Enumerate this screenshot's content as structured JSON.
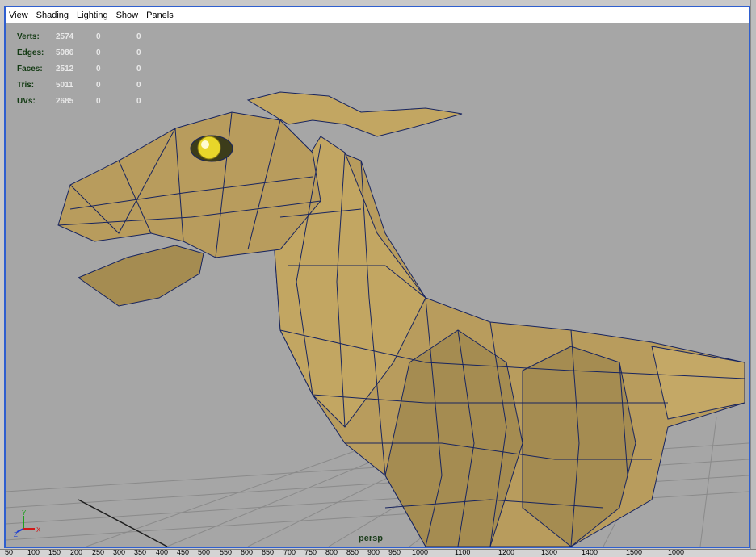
{
  "menu": [
    "View",
    "Shading",
    "Lighting",
    "Show",
    "Panels"
  ],
  "hud": [
    {
      "label": "Verts:",
      "value": "2574",
      "a": "0",
      "b": "0"
    },
    {
      "label": "Edges:",
      "value": "5086",
      "a": "0",
      "b": "0"
    },
    {
      "label": "Faces:",
      "value": "2512",
      "a": "0",
      "b": "0"
    },
    {
      "label": "Tris:",
      "value": "5011",
      "a": "0",
      "b": "0"
    },
    {
      "label": "UVs:",
      "value": "2685",
      "a": "0",
      "b": "0"
    }
  ],
  "camera": "persp",
  "axis": {
    "y": "Y",
    "z": "Z",
    "x": "X"
  },
  "ruler": [
    "50",
    "100",
    "150",
    "200",
    "250",
    "300",
    "350",
    "400",
    "450",
    "500",
    "550",
    "600",
    "650",
    "700",
    "750",
    "800",
    "850",
    "900",
    "950",
    "1000",
    "1100",
    "1200",
    "1300",
    "1400",
    "1500",
    "1000"
  ],
  "colors": {
    "background": "#a6a6a6",
    "model": "#b89c5d",
    "wire": "#17245f",
    "frame": "#2f5fcf"
  }
}
